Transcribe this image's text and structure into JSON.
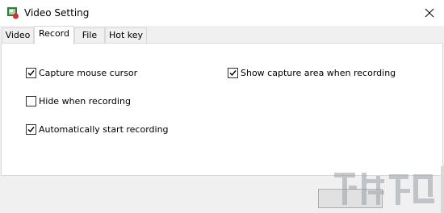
{
  "window": {
    "title": "Video Setting",
    "icon": "video-setting-app-icon",
    "close_icon": "close-icon"
  },
  "tabs": [
    {
      "label": "Video",
      "active": false
    },
    {
      "label": "Record",
      "active": true
    },
    {
      "label": "File",
      "active": false
    },
    {
      "label": "Hot key",
      "active": false
    }
  ],
  "record": {
    "capture_mouse_cursor": {
      "label": "Capture mouse cursor",
      "checked": true
    },
    "show_capture_area": {
      "label": "Show capture area when recording",
      "checked": true
    },
    "hide_when_recording": {
      "label": "Hide when recording",
      "checked": false
    },
    "auto_start_recording": {
      "label": "Automatically start recording",
      "checked": true
    }
  },
  "colors": {
    "panel_background": "#ffffff",
    "window_background": "#f0f0f0",
    "border": "#d9d9d9"
  }
}
